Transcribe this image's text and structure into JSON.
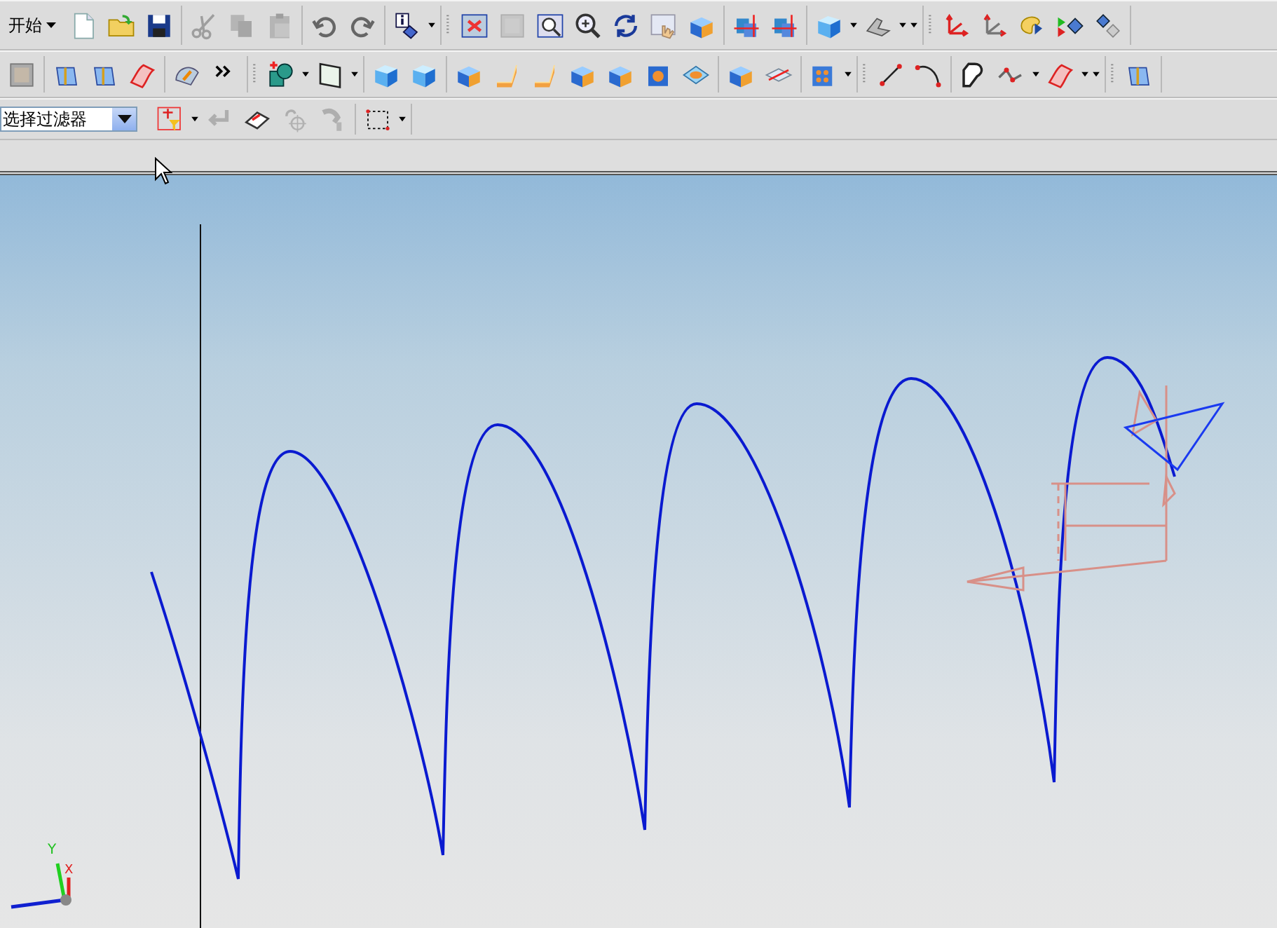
{
  "menu": {
    "label": "开始"
  },
  "toolbar_rows": [
    {
      "groups": [
        [
          {
            "kind": "document",
            "disabled": false
          },
          {
            "kind": "folder",
            "disabled": false
          },
          {
            "kind": "floppy",
            "disabled": false
          }
        ],
        [
          {
            "kind": "scissors",
            "disabled": true
          },
          {
            "kind": "pages",
            "disabled": true
          },
          {
            "kind": "clipboard",
            "disabled": true
          }
        ],
        [
          {
            "kind": "undo",
            "disabled": false
          },
          {
            "kind": "redo",
            "disabled": false
          }
        ],
        [
          {
            "kind": "info",
            "disabled": false
          },
          {
            "kind": "caret",
            "disabled": false
          }
        ],
        [
          {
            "kind": "grip",
            "disabled": false
          },
          {
            "kind": "fit",
            "disabled": false
          },
          {
            "kind": "frame",
            "disabled": true
          },
          {
            "kind": "zoombox",
            "disabled": false
          },
          {
            "kind": "zoom",
            "disabled": false
          },
          {
            "kind": "rotate",
            "disabled": false
          },
          {
            "kind": "hand",
            "disabled": false
          },
          {
            "kind": "block",
            "disabled": false
          }
        ],
        [
          {
            "kind": "section",
            "disabled": false
          },
          {
            "kind": "section",
            "disabled": false
          }
        ],
        [
          {
            "kind": "cube",
            "disabled": false
          },
          {
            "kind": "caret",
            "disabled": false
          },
          {
            "kind": "shade",
            "disabled": false
          },
          {
            "kind": "caret",
            "disabled": false
          },
          {
            "kind": "caret",
            "disabled": false
          }
        ],
        [
          {
            "kind": "grip",
            "disabled": false
          },
          {
            "kind": "axes",
            "disabled": false
          },
          {
            "kind": "axes2",
            "disabled": false
          },
          {
            "kind": "palette",
            "disabled": false
          },
          {
            "kind": "play",
            "disabled": false
          },
          {
            "kind": "diamond",
            "disabled": false
          }
        ]
      ]
    },
    {
      "groups": [
        [
          {
            "kind": "frame",
            "disabled": false
          }
        ],
        [
          {
            "kind": "prism",
            "disabled": false
          },
          {
            "kind": "prism",
            "disabled": false
          },
          {
            "kind": "surface",
            "disabled": false
          }
        ],
        [
          {
            "kind": "dial",
            "disabled": false
          },
          {
            "kind": "chevron",
            "disabled": false
          }
        ],
        [
          {
            "kind": "grip",
            "disabled": false
          },
          {
            "kind": "sketch",
            "disabled": false
          },
          {
            "kind": "caret",
            "disabled": false
          },
          {
            "kind": "plane",
            "disabled": false
          },
          {
            "kind": "caret",
            "disabled": false
          }
        ],
        [
          {
            "kind": "cube",
            "disabled": false
          },
          {
            "kind": "cube",
            "disabled": false
          }
        ],
        [
          {
            "kind": "block",
            "disabled": false
          },
          {
            "kind": "bend",
            "disabled": false
          },
          {
            "kind": "bend",
            "disabled": false
          },
          {
            "kind": "block",
            "disabled": false
          },
          {
            "kind": "block",
            "disabled": false
          },
          {
            "kind": "hole",
            "disabled": false
          },
          {
            "kind": "pocket",
            "disabled": false
          }
        ],
        [
          {
            "kind": "block",
            "disabled": false
          },
          {
            "kind": "slab",
            "disabled": false
          }
        ],
        [
          {
            "kind": "pattern",
            "disabled": false
          },
          {
            "kind": "caret",
            "disabled": false
          }
        ],
        [
          {
            "kind": "grip",
            "disabled": false
          },
          {
            "kind": "line",
            "disabled": false
          },
          {
            "kind": "arc",
            "disabled": false
          }
        ],
        [
          {
            "kind": "outline",
            "disabled": false
          },
          {
            "kind": "spline",
            "disabled": false
          },
          {
            "kind": "caret",
            "disabled": false
          },
          {
            "kind": "surface",
            "disabled": false
          },
          {
            "kind": "caret",
            "disabled": false
          },
          {
            "kind": "caret",
            "disabled": false
          }
        ],
        [
          {
            "kind": "grip",
            "disabled": false
          },
          {
            "kind": "prism",
            "disabled": false
          }
        ]
      ]
    }
  ],
  "selection_bar": {
    "filter": {
      "value": "选择过滤器"
    },
    "groups": [
      [
        {
          "kind": "filter",
          "disabled": false
        },
        {
          "kind": "caret",
          "disabled": false
        },
        {
          "kind": "return",
          "disabled": true
        },
        {
          "kind": "eraser",
          "disabled": false
        },
        {
          "kind": "snap",
          "disabled": true
        },
        {
          "kind": "smudge",
          "disabled": true
        }
      ],
      [
        {
          "kind": "boxselect",
          "disabled": false
        },
        {
          "kind": "caret",
          "disabled": false
        }
      ]
    ]
  },
  "viewport": {
    "triad": {
      "x_label": "X",
      "y_label": "Y"
    }
  }
}
